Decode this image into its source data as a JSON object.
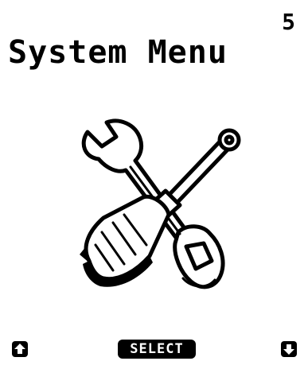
{
  "header": {
    "page_number": "5",
    "title": "System Menu"
  },
  "illustration": {
    "icon": "wrench-and-screwdriver-icon"
  },
  "softkeys": {
    "left_icon": "arrow-up-icon",
    "center_label": "SELECT",
    "right_icon": "arrow-down-icon"
  },
  "colors": {
    "foreground": "#000000",
    "background": "#ffffff"
  }
}
